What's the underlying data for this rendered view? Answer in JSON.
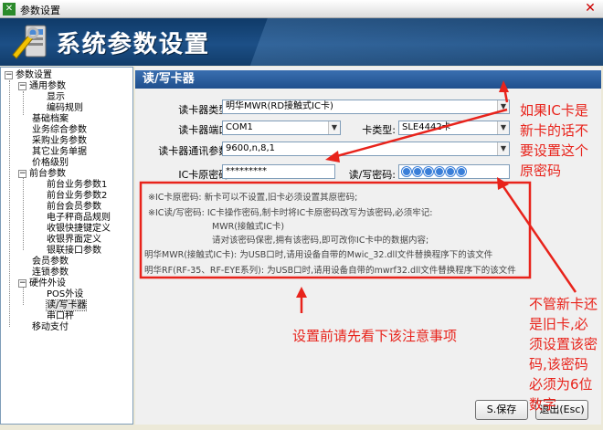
{
  "window": {
    "title": "参数设置",
    "app_icon": "settings-app-icon",
    "close_glyph": "✕"
  },
  "banner": {
    "title": "系统参数设置",
    "logo": "tools-logo-icon"
  },
  "tree": {
    "n0": "参数设置",
    "n1": "通用参数",
    "n2": "显示",
    "n3": "编码规则",
    "n4": "基础档案",
    "n5": "业务综合参数",
    "n6": "采购业务参数",
    "n7": "其它业务单据",
    "n8": "价格级别",
    "n9": "前台参数",
    "n10": "前台业务参数1",
    "n11": "前台业务参数2",
    "n12": "前台会员参数",
    "n13": "电子秤商品规则",
    "n14": "收银快捷键定义",
    "n15": "收银界面定义",
    "n16": "银联接口参数",
    "n17": "会员参数",
    "n18": "连锁参数",
    "n19": "硬件外设",
    "n20": "POS外设",
    "n21": "读/写卡器",
    "n22": "串口秤",
    "n23": "移动支付"
  },
  "main": {
    "header": "读/写卡器",
    "reader_type_label": "读卡器类型:",
    "reader_type_value": "明华MWR(RD接触式IC卡)",
    "port_label": "读卡器端口:",
    "port_value": "COM1",
    "card_type_label": "卡类型:",
    "card_type_value": "SLE4442卡",
    "comm_label": "读卡器通讯参数:",
    "comm_value": "9600,n,8,1",
    "orig_pwd_label": "IC卡原密码:",
    "orig_pwd_value": "*********",
    "rw_pwd_label": "读/写密码:",
    "notes": {
      "line1": "※IC卡原密码: 新卡可以不设置,旧卡必须设置其原密码;",
      "line2": "※IC读/写密码: IC卡操作密码,制卡时将IC卡原密码改写为该密码,必须牢记:",
      "line3": "MWR(接触式IC卡)",
      "line4": "请对该密码保密,拥有该密码,即可改你IC卡中的数据内容;",
      "line5": "明华MWR(接触式IC卡): 为USB口时,请用设备自带的Mwic_32.dll文件替换程序下的该文件",
      "line6": "明华RF(RF-35、RF-EYE系列): 为USB口时,请用设备自带的mwrf32.dll文件替换程序下的该文件"
    },
    "save_label": "S.保存",
    "exit_label": "退出(Esc)"
  },
  "annotations": {
    "a1": "如果IC卡是",
    "a2": "新卡的话不",
    "a3": "要设置这个",
    "a4": "原密码",
    "b1": "不管新卡还",
    "b2": "是旧卡,必",
    "b3": "须设置该密",
    "b4": "码,该密码",
    "b5": "必须为6位",
    "b6": "数字",
    "c1": "设置前请先看下该注意事项"
  },
  "colors": {
    "annotation_red": "#e8231b",
    "header_blue": "#1f4f8d",
    "password_dot": "#3a7fd9"
  }
}
